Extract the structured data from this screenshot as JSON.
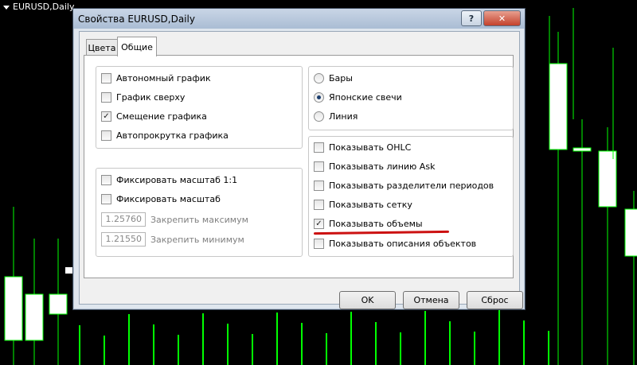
{
  "chart": {
    "symbol_label": "EURUSD,Daily",
    "colors": {
      "background": "#000000",
      "candle": "#00ff00",
      "candle_body_fill": "#ffffff",
      "wick": "#00ff00"
    }
  },
  "dialog": {
    "title": "Свойства EURUSD,Daily",
    "help_label": "?",
    "close_label": "✕",
    "tabs": [
      {
        "label": "Цвета"
      },
      {
        "label": "Общие"
      }
    ],
    "active_tab": "Общие",
    "chart_options": [
      {
        "label": "Автономный график",
        "checked": false
      },
      {
        "label": "График сверху",
        "checked": false
      },
      {
        "label": "Смещение графика",
        "checked": true
      },
      {
        "label": "Автопрокрутка графика",
        "checked": false
      }
    ],
    "scale": {
      "fix_scale_1_1": {
        "label": "Фиксировать масштаб 1:1",
        "checked": false
      },
      "fix_scale": {
        "label": "Фиксировать масштаб",
        "checked": false
      },
      "max": {
        "value": "1.25760",
        "label": "Закрепить максимум"
      },
      "min": {
        "value": "1.21550",
        "label": "Закрепить минимум"
      }
    },
    "chart_types": [
      {
        "label": "Бары",
        "selected": false
      },
      {
        "label": "Японские свечи",
        "selected": true
      },
      {
        "label": "Линия",
        "selected": false
      }
    ],
    "show_options": [
      {
        "label": "Показывать OHLC",
        "checked": false
      },
      {
        "label": "Показывать линию Ask",
        "checked": false
      },
      {
        "label": "Показывать разделители периодов",
        "checked": false
      },
      {
        "label": "Показывать сетку",
        "checked": false
      },
      {
        "label": "Показывать объемы",
        "checked": true,
        "highlighted": true
      },
      {
        "label": "Показывать описания объектов",
        "checked": false
      }
    ],
    "buttons": {
      "ok": "OK",
      "cancel": "Отмена",
      "reset": "Сброс"
    }
  }
}
